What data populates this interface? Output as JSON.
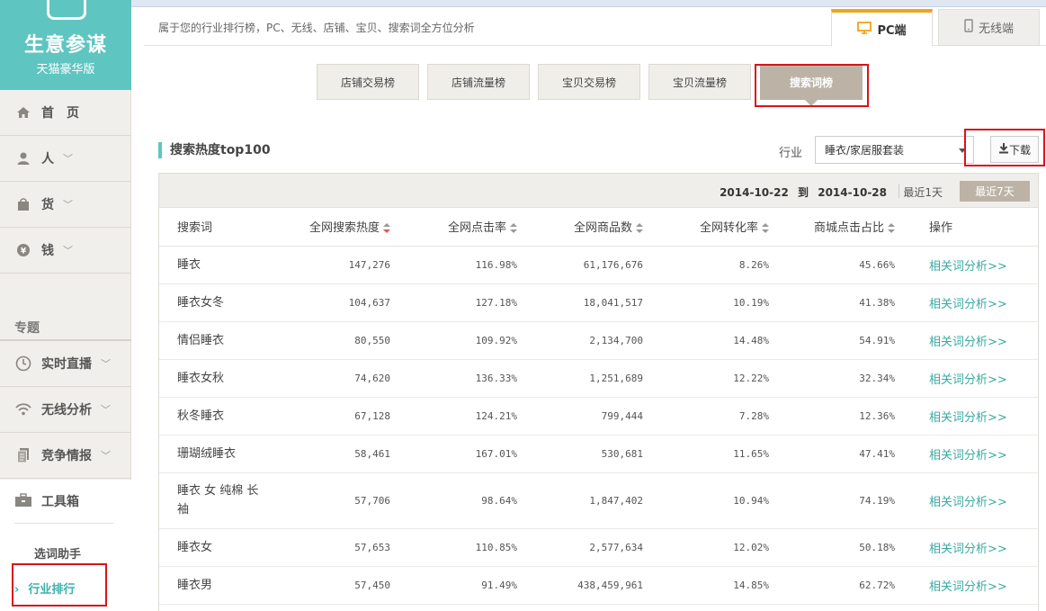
{
  "brand": {
    "name": "生意参谋",
    "edition": "天猫豪华版"
  },
  "sidebar": {
    "items": [
      {
        "label": "首　页",
        "icon": "home-icon"
      },
      {
        "label": "人",
        "icon": "person-icon"
      },
      {
        "label": "货",
        "icon": "bag-icon"
      },
      {
        "label": "钱",
        "icon": "money-icon"
      }
    ],
    "section_title": "专题",
    "topics": [
      {
        "label": "实时直播",
        "icon": "clock-icon"
      },
      {
        "label": "无线分析",
        "icon": "wifi-icon"
      },
      {
        "label": "竞争情报",
        "icon": "document-icon"
      }
    ],
    "toolbox": {
      "label": "工具箱",
      "sub": [
        "选词助手",
        "行业排行"
      ]
    }
  },
  "header": {
    "tagline": "属于您的行业排行榜，PC、无线、店铺、宝贝、搜索词全方位分析",
    "tabs": [
      {
        "label": "PC端"
      },
      {
        "label": "无线端"
      }
    ]
  },
  "subtabs": [
    "店铺交易榜",
    "店铺流量榜",
    "宝贝交易榜",
    "宝贝流量榜",
    "搜索词榜"
  ],
  "section": {
    "title": "搜索热度top100",
    "industry_label": "行业",
    "industry_value": "睡衣/家居服套装",
    "download_label": "下载"
  },
  "datebar": {
    "range_start": "2014-10-22",
    "range_to": "到",
    "range_end": "2014-10-28",
    "opt1": "最近1天",
    "opt7": "最近7天"
  },
  "table": {
    "headers": [
      "搜索词",
      "全网搜索热度",
      "全网点击率",
      "全网商品数",
      "全网转化率",
      "商城点击占比",
      "操作"
    ],
    "rows": [
      [
        "睡衣",
        "147,276",
        "116.98%",
        "61,176,676",
        "8.26%",
        "45.66%",
        "相关词分析>>"
      ],
      [
        "睡衣女冬",
        "104,637",
        "127.18%",
        "18,041,517",
        "10.19%",
        "41.38%",
        "相关词分析>>"
      ],
      [
        "情侣睡衣",
        "80,550",
        "109.92%",
        "2,134,700",
        "14.48%",
        "54.91%",
        "相关词分析>>"
      ],
      [
        "睡衣女秋",
        "74,620",
        "136.33%",
        "1,251,689",
        "12.22%",
        "32.34%",
        "相关词分析>>"
      ],
      [
        "秋冬睡衣",
        "67,128",
        "124.21%",
        "799,444",
        "7.28%",
        "12.36%",
        "相关词分析>>"
      ],
      [
        "珊瑚绒睡衣",
        "58,461",
        "167.01%",
        "530,681",
        "11.65%",
        "47.41%",
        "相关词分析>>"
      ],
      [
        "睡衣 女 纯棉 长袖",
        "57,706",
        "98.64%",
        "1,847,402",
        "10.94%",
        "74.19%",
        "相关词分析>>"
      ],
      [
        "睡衣女",
        "57,653",
        "110.85%",
        "2,577,634",
        "12.02%",
        "50.18%",
        "相关词分析>>"
      ],
      [
        "睡衣男",
        "57,450",
        "91.49%",
        "438,459,961",
        "14.85%",
        "62.72%",
        "相关词分析>>"
      ]
    ]
  },
  "colors": {
    "teal": "#5fc5c1",
    "accent_orange": "#f0a41b",
    "highlight_red": "#d8141a",
    "active_tab": "#bcb3a6"
  }
}
